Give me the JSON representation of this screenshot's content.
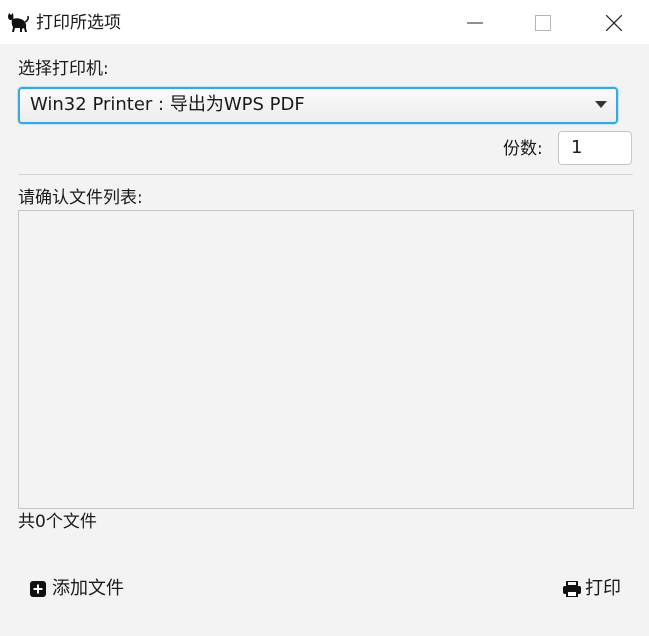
{
  "window": {
    "title": "打印所选项",
    "app_icon": "black-cat-icon",
    "controls": [
      "minimize-icon",
      "maximize-icon",
      "close-icon"
    ]
  },
  "printer": {
    "label": "选择打印机:",
    "selected": "Win32 Printer : 导出为WPS PDF"
  },
  "copies": {
    "label": "份数:",
    "value": "1"
  },
  "file_list": {
    "label": "请确认文件列表:",
    "items": [],
    "count_text": "共0个文件"
  },
  "footer": {
    "add_file_label": "添加文件",
    "add_file_icon": "plus-square-icon",
    "print_label": "打印",
    "print_icon": "printer-icon"
  },
  "colors": {
    "accent_border": "#3aa7e0",
    "background": "#f3f3f3"
  }
}
